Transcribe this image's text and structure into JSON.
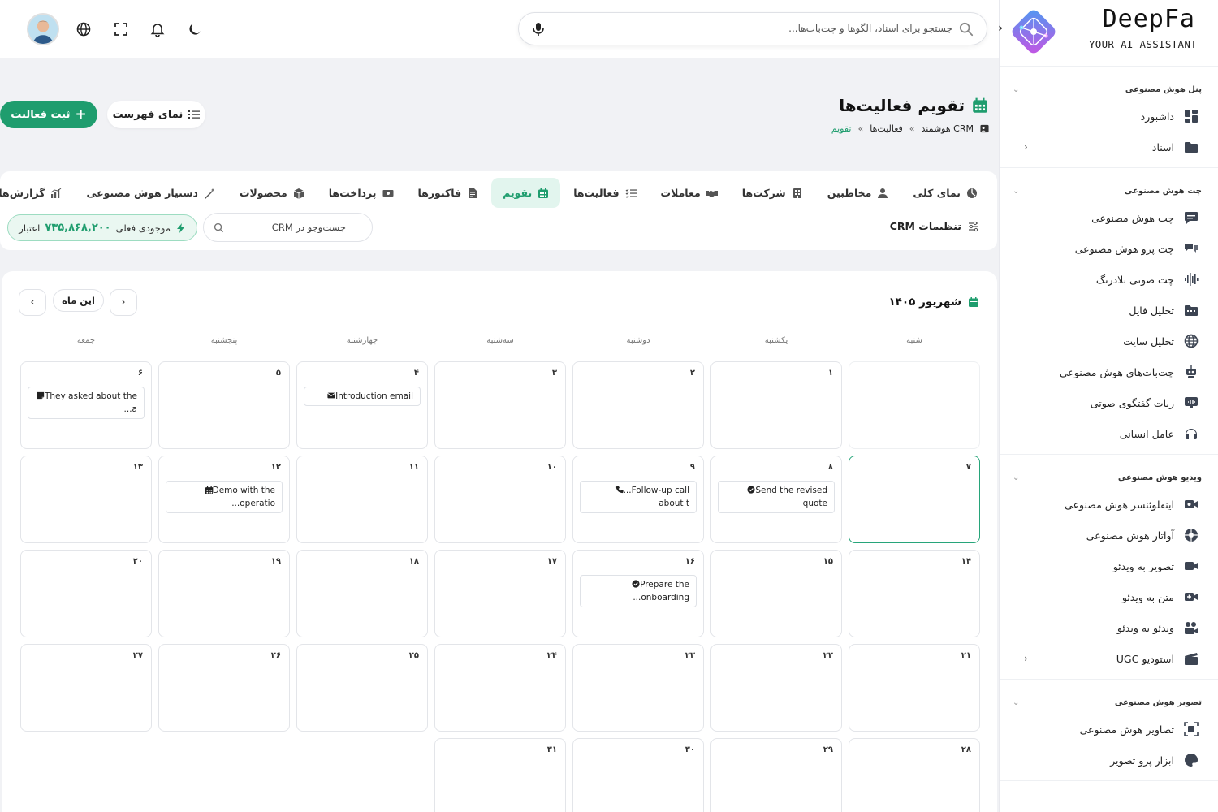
{
  "brand": {
    "name": "DeepFa",
    "tagline": "YOUR AI ASSISTANT"
  },
  "topbar": {
    "search_placeholder": "جستجو برای اسناد، الگوها و چت‌بات‌ها..."
  },
  "sidebar": {
    "sections": [
      {
        "title": "پنل هوش مصنوعی",
        "items": [
          {
            "label": "داشبورد",
            "icon": "dashboard-icon"
          },
          {
            "label": "اسناد",
            "icon": "folder-icon",
            "arrow": true
          }
        ]
      },
      {
        "title": "چت هوش مصنوعی",
        "items": [
          {
            "label": "چت هوش مصنوعی",
            "icon": "chat-icon"
          },
          {
            "label": "چت پرو هوش مصنوعی",
            "icon": "chats-icon"
          },
          {
            "label": "چت صوتی بلادرنگ",
            "icon": "waveform-icon"
          },
          {
            "label": "تحلیل فایل",
            "icon": "file-folder-icon"
          },
          {
            "label": "تحلیل سایت",
            "icon": "globe-icon"
          },
          {
            "label": "چت‌بات‌های هوش مصنوعی",
            "icon": "robot-icon"
          },
          {
            "label": "ربات گفتگوی صوتی",
            "icon": "voice-bot-icon"
          },
          {
            "label": "عامل انسانی",
            "icon": "headset-icon"
          }
        ]
      },
      {
        "title": "ویدیو هوش مصنوعی",
        "items": [
          {
            "label": "اینفلوئنسر هوش مصنوعی",
            "icon": "influencer-icon"
          },
          {
            "label": "آواتار هوش مصنوعی",
            "icon": "avatar-icon"
          },
          {
            "label": "تصویر به ویدئو",
            "icon": "video-camera-icon"
          },
          {
            "label": "متن به ویدئو",
            "icon": "video-plus-icon"
          },
          {
            "label": "ویدئو به ویدئو",
            "icon": "users-video-icon"
          },
          {
            "label": "استودیو UGC",
            "icon": "clapper-icon",
            "arrow": true
          }
        ]
      },
      {
        "title": "تصویر هوش مصنوعی",
        "items": [
          {
            "label": "تصاویر هوش مصنوعی",
            "icon": "image-scan-icon"
          },
          {
            "label": "ابزار پرو تصویر",
            "icon": "palette-icon"
          }
        ]
      }
    ]
  },
  "page": {
    "title": "تقویم فعالیت‌ها",
    "breadcrumb": [
      "CRM هوشمند",
      "فعالیت‌ها",
      "تقویم"
    ],
    "breadcrumb_sep": "»",
    "new_button": "ثبت فعالیت",
    "list_button": "نمای فهرست"
  },
  "nav": {
    "tabs": [
      {
        "label": "نمای کلی",
        "icon": "overview-icon"
      },
      {
        "label": "مخاطبین",
        "icon": "contacts-icon"
      },
      {
        "label": "شرکت‌ها",
        "icon": "building-icon"
      },
      {
        "label": "معاملات",
        "icon": "handshake-icon"
      },
      {
        "label": "فعالیت‌ها",
        "icon": "list-check-icon"
      },
      {
        "label": "تقویم",
        "icon": "calendar-icon",
        "active": true
      },
      {
        "label": "فاکتورها",
        "icon": "invoice-icon"
      },
      {
        "label": "پرداخت‌ها",
        "icon": "money-icon"
      },
      {
        "label": "محصولات",
        "icon": "box-icon"
      },
      {
        "label": "دستیار هوش مصنوعی",
        "icon": "magic-wand-icon"
      },
      {
        "label": "گزارش‌ها",
        "icon": "chart-icon"
      }
    ],
    "settings_label": "تنظیمات CRM",
    "search_placeholder": "جست‌وجو در CRM",
    "balance_label": "موجودی فعلی",
    "balance_value": "۷۳۵,۸۶۸,۲۰۰",
    "balance_unit": "اعتبار"
  },
  "calendar": {
    "month_title": "شهریور ۱۴۰۵",
    "this_month": "این ماه",
    "weekdays": [
      "شنبه",
      "یکشنبه",
      "دوشنبه",
      "سه‌شنبه",
      "چهارشنبه",
      "پنجشنبه",
      "جمعه"
    ],
    "days": [
      {
        "n": ""
      },
      {
        "n": "۱"
      },
      {
        "n": "۲"
      },
      {
        "n": "۳"
      },
      {
        "n": "۴",
        "event": {
          "text": "Introduction email",
          "icon": "envelope-icon"
        }
      },
      {
        "n": "۵"
      },
      {
        "n": "۶",
        "event": {
          "text": "They asked about the ...a",
          "icon": "note-icon"
        }
      },
      {
        "n": "۷",
        "today": true
      },
      {
        "n": "۸",
        "event": {
          "text": "Send the revised quote",
          "icon": "check-circle-icon"
        }
      },
      {
        "n": "۹",
        "event": {
          "text": "...Follow-up call about t",
          "icon": "phone-icon"
        }
      },
      {
        "n": "۱۰"
      },
      {
        "n": "۱۱"
      },
      {
        "n": "۱۲",
        "event": {
          "text": "Demo with the ...operatio",
          "icon": "calendar-icon"
        }
      },
      {
        "n": "۱۳"
      },
      {
        "n": "۱۴"
      },
      {
        "n": "۱۵"
      },
      {
        "n": "۱۶",
        "event": {
          "text": "Prepare the ...onboarding",
          "icon": "check-circle-icon"
        }
      },
      {
        "n": "۱۷"
      },
      {
        "n": "۱۸"
      },
      {
        "n": "۱۹"
      },
      {
        "n": "۲۰"
      },
      {
        "n": "۲۱"
      },
      {
        "n": "۲۲"
      },
      {
        "n": "۲۳"
      },
      {
        "n": "۲۴"
      },
      {
        "n": "۲۵"
      },
      {
        "n": "۲۶"
      },
      {
        "n": "۲۷"
      },
      {
        "n": "۲۸"
      },
      {
        "n": "۲۹"
      },
      {
        "n": "۳۰"
      },
      {
        "n": "۳۱"
      }
    ]
  },
  "colors": {
    "accent": "#1f9d6e",
    "accent_light": "#e2f5ee",
    "background": "#f1f2f5"
  }
}
